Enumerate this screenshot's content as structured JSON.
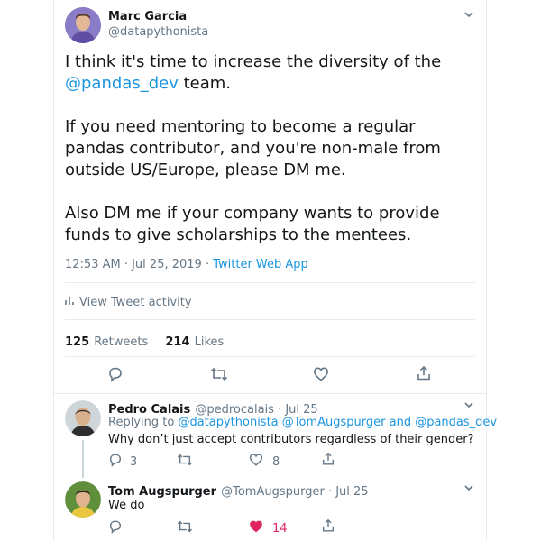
{
  "tweet": {
    "author_name": "Marc Garcia",
    "author_handle": "@datapythonista",
    "line1": "I think it's time to increase the diversity of the",
    "mention": "@pandas_dev",
    "line2_rest": " team.",
    "para2": [
      "If you need mentoring to become a regular",
      "pandas contributor, and you're non-male from",
      "outside US/Europe, please DM me."
    ],
    "para3": [
      "Also DM me if your company wants to provide",
      "funds to give scholarships to the mentees."
    ],
    "timestamp": "12:53 AM · Jul 25, 2019 · ",
    "source": "Twitter Web App",
    "activity_label": "View Tweet activity",
    "retweets_count": "125",
    "retweets_label": "Retweets",
    "likes_count": "214",
    "likes_label": "Likes"
  },
  "replies": [
    {
      "author_name": "Pedro Calais",
      "author_handle": "@pedrocalais · Jul 25",
      "replying_prefix": "Replying to ",
      "replying_targets": "@datapythonista @TomAugspurger and @pandas_dev",
      "text": "Why don’t just accept contributors regardless of their gender?",
      "reply_count": "3",
      "like_count": "8"
    },
    {
      "author_name": "Tom Augspurger",
      "author_handle": "@TomAugspurger · Jul 25",
      "text": "We do",
      "like_count": "14"
    }
  ],
  "colors": {
    "accent": "#1b95e0",
    "like": "#e0245e",
    "muted": "#657786"
  }
}
